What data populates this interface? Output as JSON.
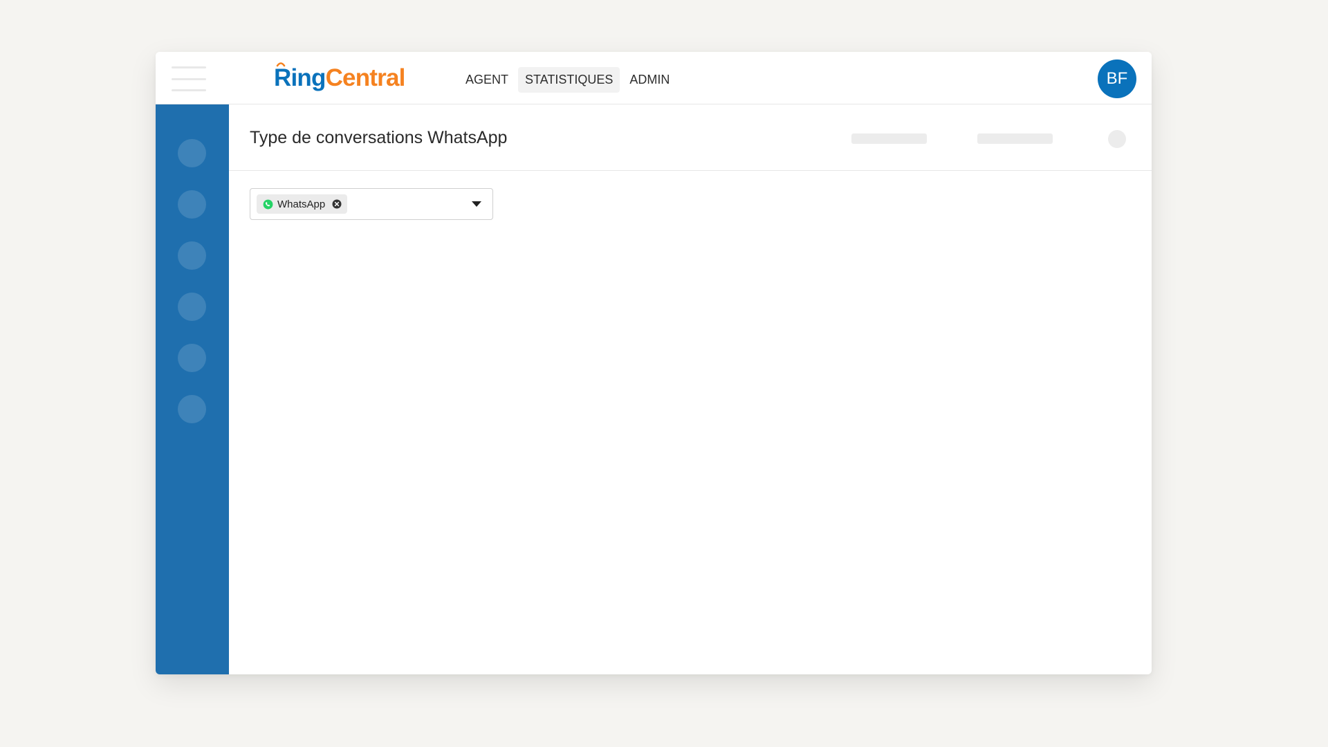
{
  "header": {
    "logo": {
      "part1": "Ring",
      "part2": "Central"
    },
    "nav": [
      {
        "label": "AGENT",
        "active": false
      },
      {
        "label": "STATISTIQUES",
        "active": true
      },
      {
        "label": "ADMIN",
        "active": false
      }
    ],
    "user": {
      "initials": "BF"
    }
  },
  "page": {
    "title": "Type de conversations WhatsApp"
  },
  "filter": {
    "selected_chip": {
      "label": "WhatsApp",
      "icon": "whatsapp-icon"
    }
  },
  "colors": {
    "brand_blue": "#0a72bb",
    "brand_orange": "#f58220",
    "sidebar": "#1f6fae",
    "whatsapp_green": "#25d366",
    "background": "#f5f4f1"
  }
}
